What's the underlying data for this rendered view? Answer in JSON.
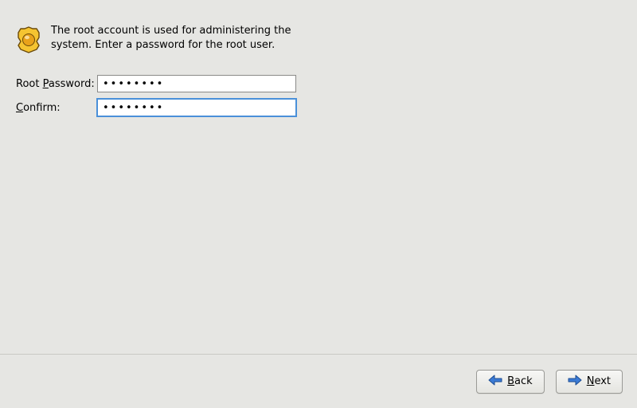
{
  "header": {
    "icon": "security-badge-icon",
    "instructions": "The root account is used for administering the system.  Enter a password for the root user."
  },
  "form": {
    "password": {
      "label_pre": "Root ",
      "label_u": "P",
      "label_post": "assword:",
      "value": "••••••••"
    },
    "confirm": {
      "label_u": "C",
      "label_post": "onfirm:",
      "value": "••••••••"
    }
  },
  "footer": {
    "back": {
      "label_u": "B",
      "label_post": "ack"
    },
    "next": {
      "label_u": "N",
      "label_post": "ext"
    }
  }
}
